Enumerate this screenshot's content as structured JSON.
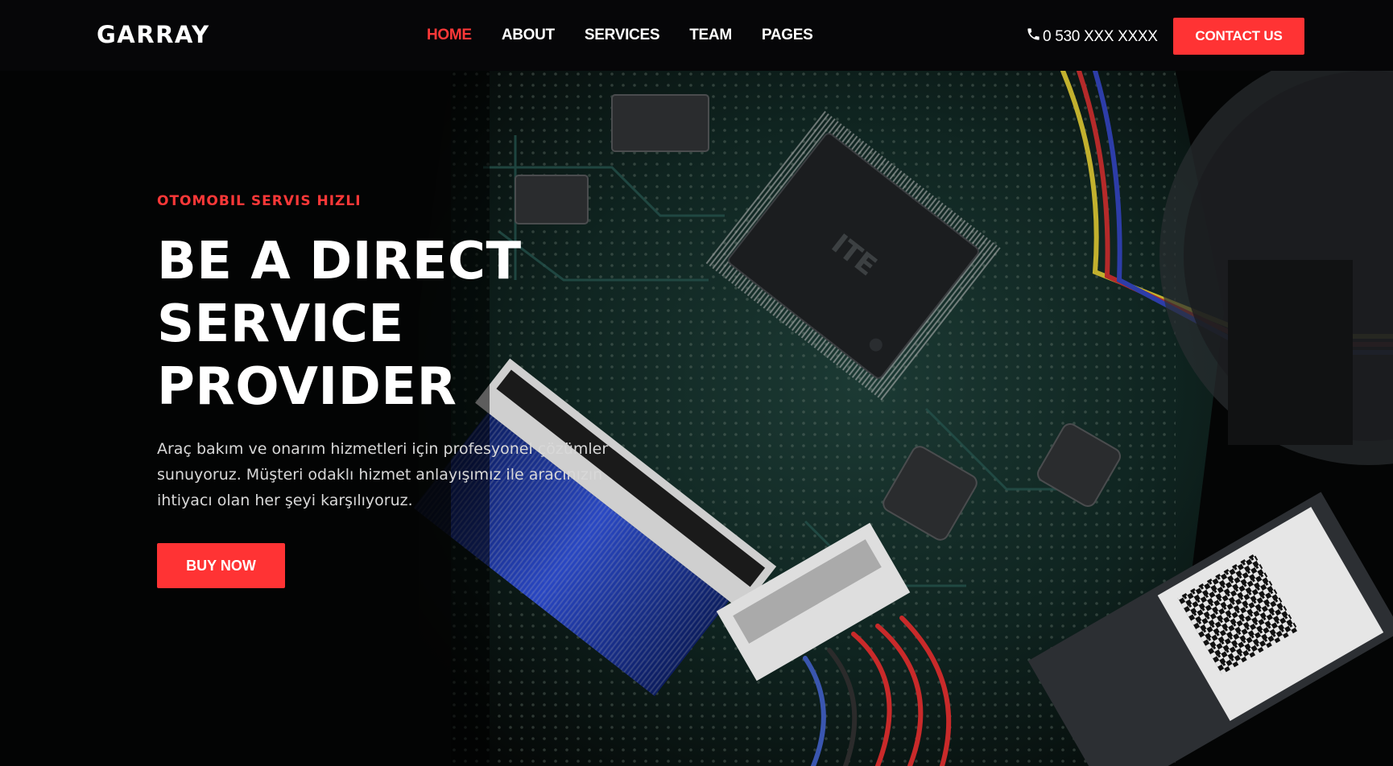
{
  "header": {
    "logo": "GARRAY",
    "nav": [
      {
        "label": "HOME",
        "active": true
      },
      {
        "label": "ABOUT",
        "active": false
      },
      {
        "label": "SERVICES",
        "active": false
      },
      {
        "label": "TEAM",
        "active": false
      },
      {
        "label": "PAGES",
        "active": false
      }
    ],
    "phone_icon": "phone-icon",
    "phone": "0 530 XXX XXXX",
    "contact_label": "CONTACT US"
  },
  "hero": {
    "background": "circuit-board-photo",
    "eyebrow": "OTOMOBIL SERVIS HIZLI",
    "headline_lines": [
      "BE A DIRECT",
      "SERVICE",
      "PROVIDER"
    ],
    "description_lines": [
      "Araç bakım ve onarım hizmetleri için profesyonel çözümler",
      "sunuyoruz. Müşteri odaklı hizmet anlayışımız ile aracınızın",
      "ihtiyacı olan her şeyi karşılıyoruz."
    ],
    "cta_label": "BUY NOW"
  },
  "colors": {
    "accent": "#ff3334",
    "nav_background": "#060608",
    "text": "#ffffff"
  }
}
